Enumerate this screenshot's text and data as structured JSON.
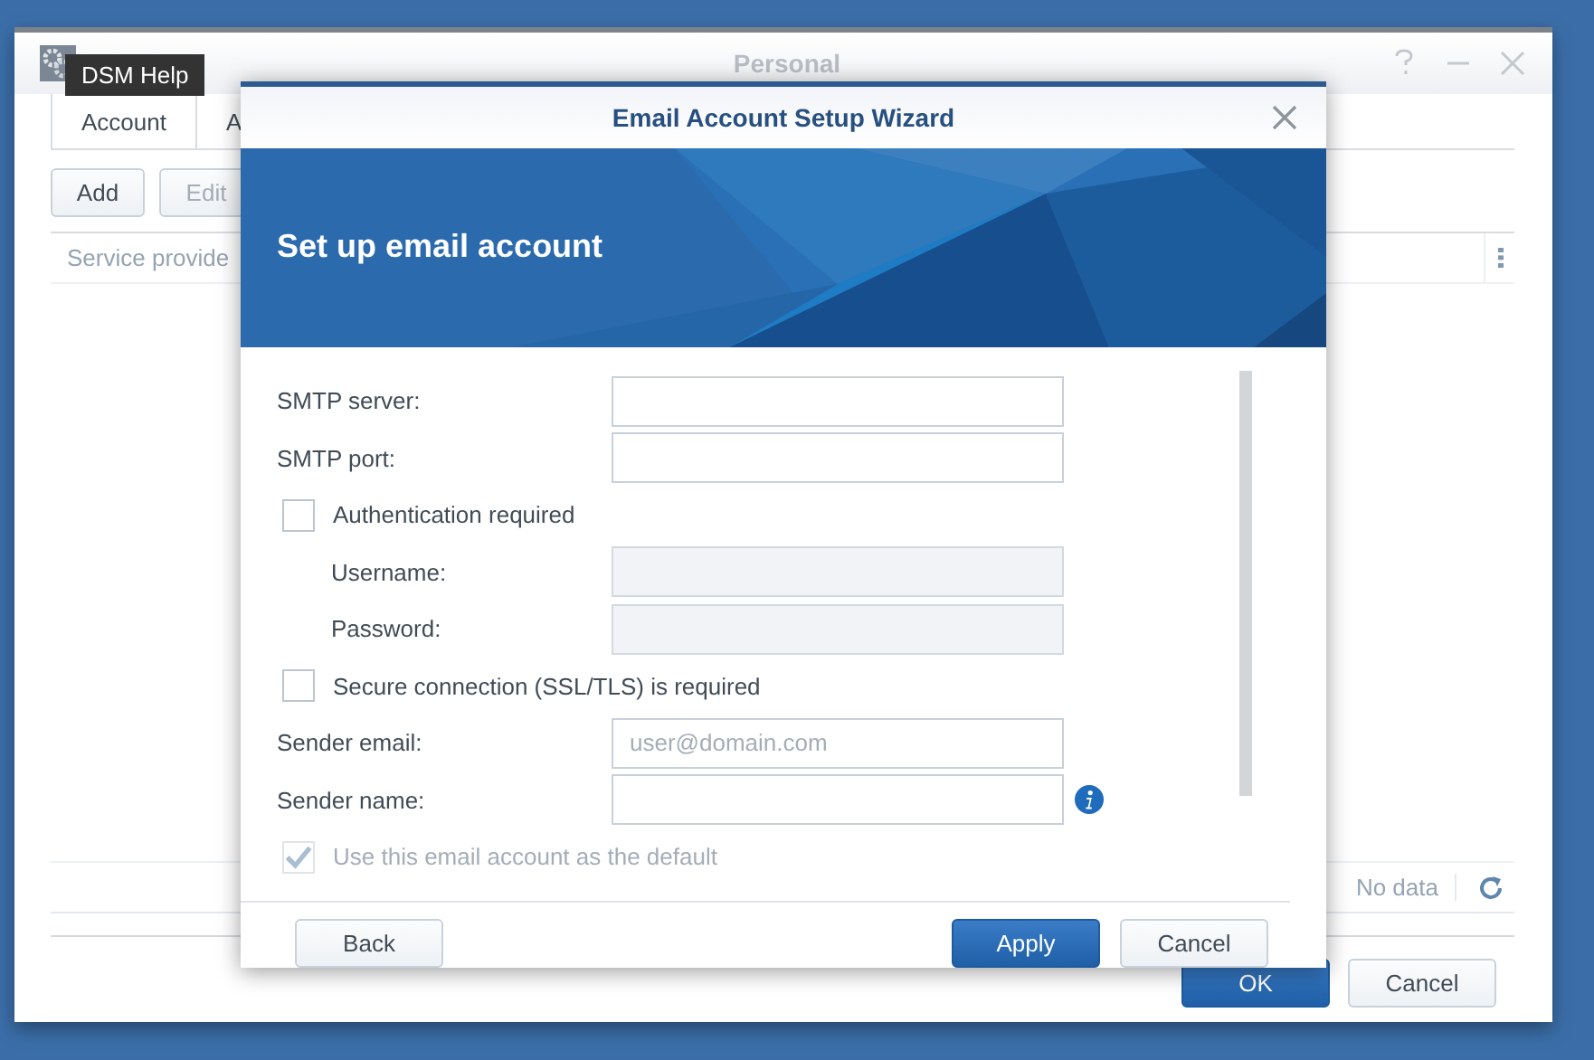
{
  "desktop": {
    "tooltip": "DSM Help"
  },
  "window": {
    "title": "Personal",
    "tabs": [
      {
        "label": "Account",
        "selected": true
      },
      {
        "label": "A",
        "selected": false
      }
    ],
    "toolbar": [
      {
        "label": "Add",
        "disabled": false
      },
      {
        "label": "Edit",
        "disabled": true
      }
    ],
    "table": {
      "columns": [
        "Service provide"
      ]
    },
    "paging": {
      "status": "No data"
    },
    "buttons": [
      {
        "label": "OK",
        "kind": "primary"
      },
      {
        "label": "Cancel",
        "kind": "default"
      }
    ]
  },
  "dialog": {
    "title": "Email Account Setup Wizard",
    "banner_title": "Set up email account",
    "fields": [
      {
        "kind": "text",
        "label": "SMTP server:",
        "disabled": false
      },
      {
        "kind": "text",
        "label": "SMTP port:",
        "disabled": false
      },
      {
        "kind": "checkbox",
        "label": "Authentication required",
        "checked": false,
        "disabled": false,
        "children": [
          {
            "kind": "text",
            "label": "Username:",
            "disabled": true
          },
          {
            "kind": "text",
            "label": "Password:",
            "disabled": true
          }
        ]
      },
      {
        "kind": "checkbox",
        "label": "Secure connection (SSL/TLS) is required",
        "checked": false,
        "disabled": false
      },
      {
        "kind": "text",
        "label": "Sender email:",
        "placeholder": "user@domain.com",
        "disabled": false
      },
      {
        "kind": "text",
        "label": "Sender name:",
        "disabled": false,
        "info": true
      },
      {
        "kind": "checkbox",
        "label": "Use this email account as the default",
        "checked": true,
        "disabled": true
      }
    ],
    "buttons": [
      {
        "label": "Back",
        "kind": "default"
      },
      {
        "label": "Apply",
        "kind": "primary"
      },
      {
        "label": "Cancel",
        "kind": "default"
      }
    ]
  }
}
